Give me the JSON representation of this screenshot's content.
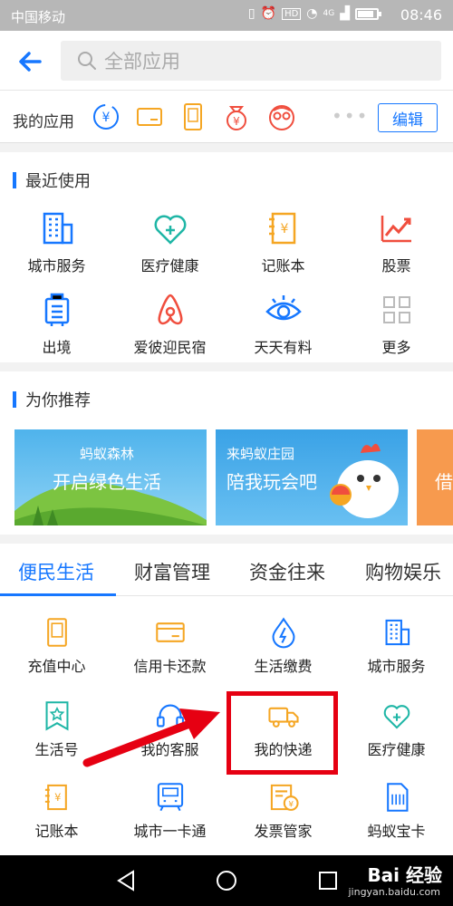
{
  "status": {
    "carrier": "中国移动",
    "time": "08:46",
    "network": "4G",
    "battery_percent": 85
  },
  "topbar": {
    "search_placeholder": "全部应用"
  },
  "my_apps": {
    "label": "我的应用",
    "icons": [
      "transfer-icon",
      "card-icon",
      "phone-icon",
      "money-bag-icon",
      "face-icon"
    ],
    "more": "•••",
    "edit_label": "编辑"
  },
  "recent": {
    "title": "最近使用",
    "items": [
      {
        "label": "城市服务",
        "icon": "building-icon"
      },
      {
        "label": "医疗健康",
        "icon": "medical-icon"
      },
      {
        "label": "记账本",
        "icon": "ledger-icon"
      },
      {
        "label": "股票",
        "icon": "stock-icon"
      },
      {
        "label": "出境",
        "icon": "luggage-icon"
      },
      {
        "label": "爱彼迎民宿",
        "icon": "airbnb-icon"
      },
      {
        "label": "天天有料",
        "icon": "eye-icon"
      },
      {
        "label": "更多",
        "icon": "grid-icon"
      }
    ]
  },
  "recommend": {
    "title": "为你推荐",
    "banners": [
      {
        "line1": "蚂蚁森林",
        "line2": "开启绿色生活"
      },
      {
        "line1": "来蚂蚁庄园",
        "line2": "陪我玩会吧"
      },
      {
        "line1": "",
        "line2": "借"
      }
    ]
  },
  "tabs": [
    {
      "label": "便民生活",
      "active": true
    },
    {
      "label": "财富管理",
      "active": false
    },
    {
      "label": "资金往来",
      "active": false
    },
    {
      "label": "购物娱乐",
      "active": false
    }
  ],
  "life": {
    "items": [
      {
        "label": "充值中心",
        "icon": "phone-icon"
      },
      {
        "label": "信用卡还款",
        "icon": "card-icon"
      },
      {
        "label": "生活缴费",
        "icon": "water-drop-icon"
      },
      {
        "label": "城市服务",
        "icon": "building-icon"
      },
      {
        "label": "生活号",
        "icon": "bookmark-star-icon"
      },
      {
        "label": "我的客服",
        "icon": "headset-icon"
      },
      {
        "label": "我的快递",
        "icon": "truck-icon"
      },
      {
        "label": "医疗健康",
        "icon": "medical-icon"
      },
      {
        "label": "记账本",
        "icon": "ledger-icon"
      },
      {
        "label": "城市一卡通",
        "icon": "transit-card-icon"
      },
      {
        "label": "发票管家",
        "icon": "invoice-icon"
      },
      {
        "label": "蚂蚁宝卡",
        "icon": "sim-card-icon"
      }
    ]
  },
  "watermark": {
    "text": "Bai 经验",
    "sub": "jingyan.baidu.com"
  },
  "colors": {
    "accent": "#1677ff",
    "orange": "#f5a623",
    "red": "#f04e3e",
    "teal": "#1fb6a6",
    "highlight": "#e60012"
  }
}
